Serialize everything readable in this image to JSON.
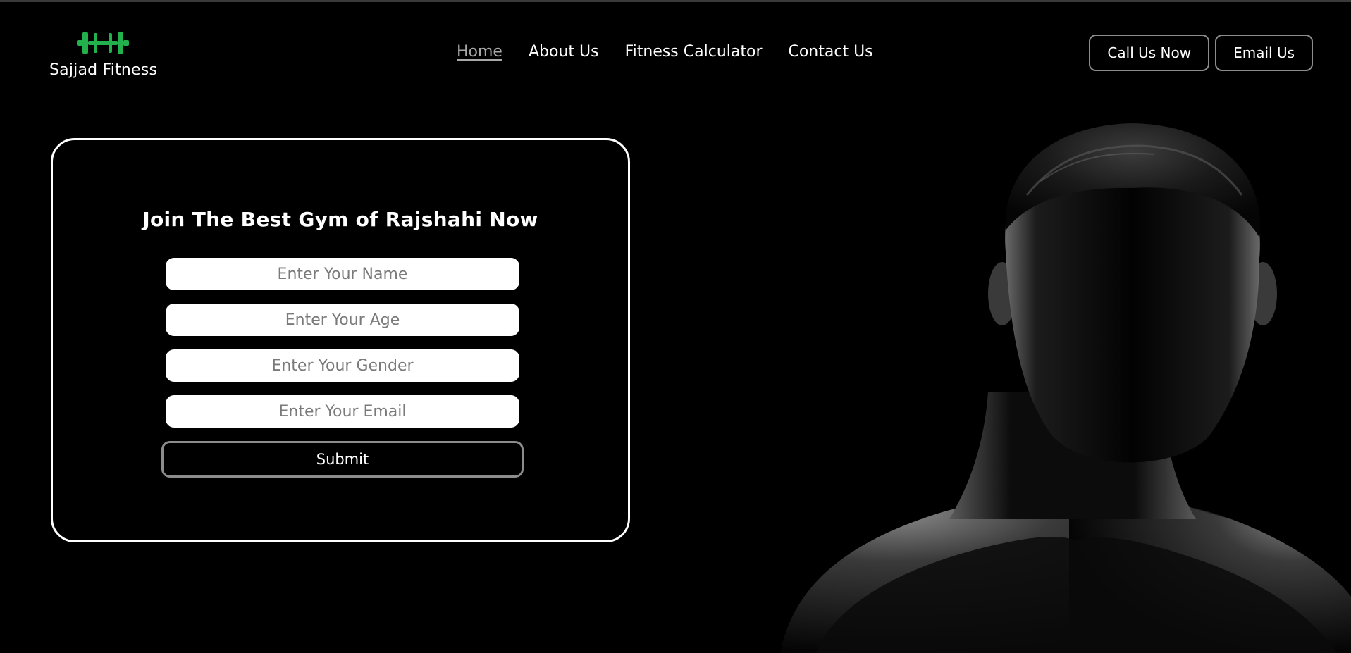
{
  "brand": {
    "name": "Sajjad Fitness",
    "logo_icon": "dumbbell-icon",
    "logo_color": "#22b14c"
  },
  "nav": {
    "items": [
      {
        "label": "Home",
        "active": true
      },
      {
        "label": "About Us",
        "active": false
      },
      {
        "label": "Fitness Calculator",
        "active": false
      },
      {
        "label": "Contact Us",
        "active": false
      }
    ]
  },
  "header_actions": {
    "call_label": "Call Us Now",
    "email_label": "Email Us"
  },
  "join_form": {
    "title": "Join The Best Gym of Rajshahi Now",
    "name_placeholder": "Enter Your Name",
    "age_placeholder": "Enter Your Age",
    "gender_placeholder": "Enter Your Gender",
    "email_placeholder": "Enter Your Email",
    "submit_label": "Submit"
  },
  "colors": {
    "background": "#000000",
    "text": "#ffffff",
    "active_link": "#a8a8a8",
    "button_border": "#8c8c8c"
  }
}
